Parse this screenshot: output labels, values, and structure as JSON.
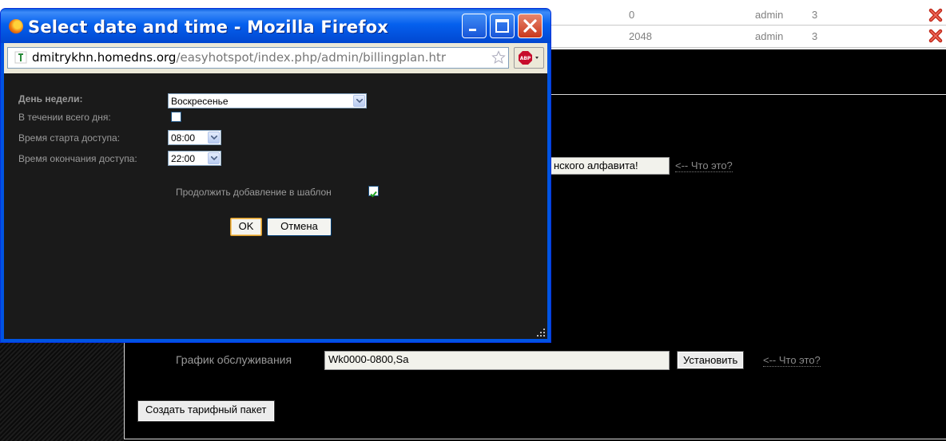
{
  "background_page": {
    "rows": [
      {
        "value": "0",
        "user": "admin",
        "count": "3"
      },
      {
        "value": "2048",
        "user": "admin",
        "count": "3"
      }
    ],
    "partial_field_text": "нского алфавита!",
    "help_link": "<-- Что это?",
    "schedule_label": "График обслуживания",
    "schedule_value": "Wk0000-0800,Sa",
    "set_button": "Установить",
    "schedule_help_link": "<-- Что это?",
    "create_plan_button": "Создать тарифный пакет"
  },
  "popup": {
    "title": "Select date and time - Mozilla Firefox",
    "url_host": "dmitrykhn.homedns.org",
    "url_path": "/easyhotspot/index.php/admin/billingplan.htr",
    "form": {
      "weekday_label": "День недели:",
      "weekday_value": "Воскресенье",
      "all_day_label": "В течении всего дня:",
      "start_label": "Время старта доступа:",
      "start_value": "08:00",
      "end_label": "Время окончания доступа:",
      "end_value": "22:00",
      "continue_label": "Продолжить добавление в шаблон",
      "ok_button": "OK",
      "cancel_button": "Отмена"
    }
  },
  "icons": {
    "delete": "red-x-icon",
    "close": "close-icon",
    "minimize": "minimize-icon",
    "maximize": "maximize-icon",
    "bookmark": "star-icon",
    "adblock": "abp-icon",
    "app": "firefox-icon"
  }
}
